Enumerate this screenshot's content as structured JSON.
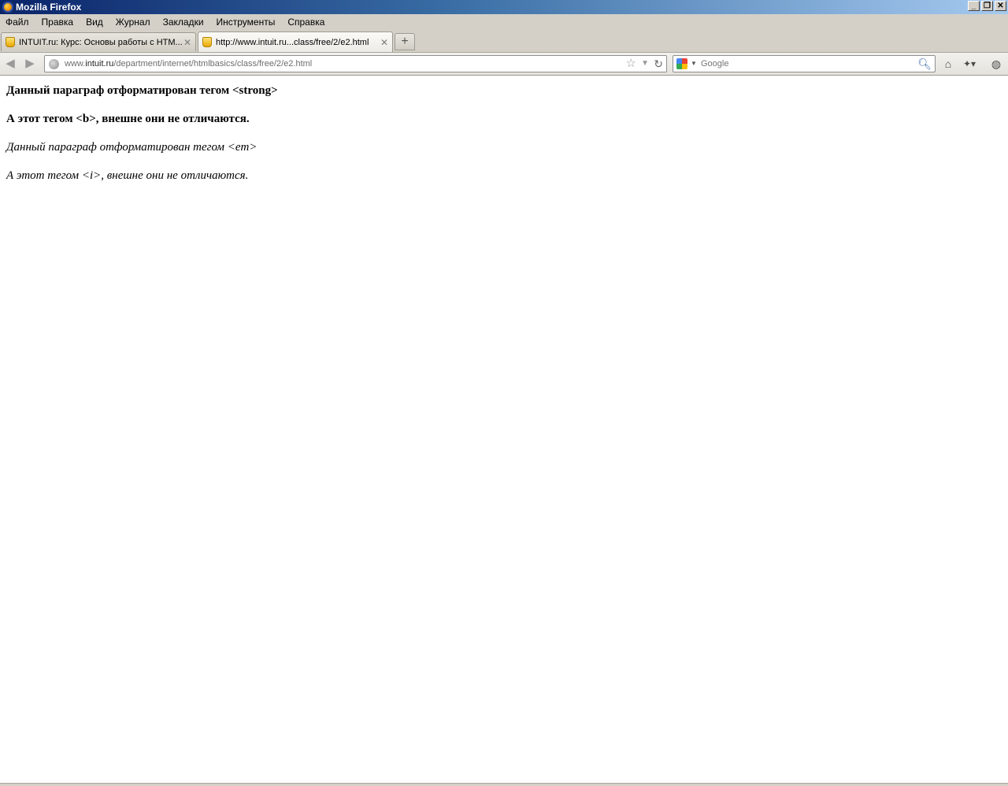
{
  "window": {
    "title": "Mozilla Firefox"
  },
  "menu": [
    "Файл",
    "Правка",
    "Вид",
    "Журнал",
    "Закладки",
    "Инструменты",
    "Справка"
  ],
  "tabs": [
    {
      "label": "INTUIT.ru: Курс: Основы работы с HTM...",
      "active": false
    },
    {
      "label": "http://www.intuit.ru...class/free/2/e2.html",
      "active": true
    }
  ],
  "newtab_label": "+",
  "urlbar": {
    "prefix": "www.",
    "domain": "intuit.ru",
    "path": "/department/internet/htmlbasics/class/free/2/e2.html"
  },
  "search": {
    "placeholder": "Google"
  },
  "content": {
    "p1": "Данный параграф отформатирован тегом <strong>",
    "p2": "А этот тегом <b>, внешне они не отличаются.",
    "p3": "Данный параграф отформатирован тегом <em>",
    "p4": "А этот тегом <i>, внешне они не отличаются."
  },
  "icons": {
    "back": "back-arrow-icon",
    "forward": "forward-arrow-icon",
    "home": "home-icon",
    "bookmark": "star-icon",
    "reload": "reload-icon",
    "search": "magnifier-icon"
  }
}
